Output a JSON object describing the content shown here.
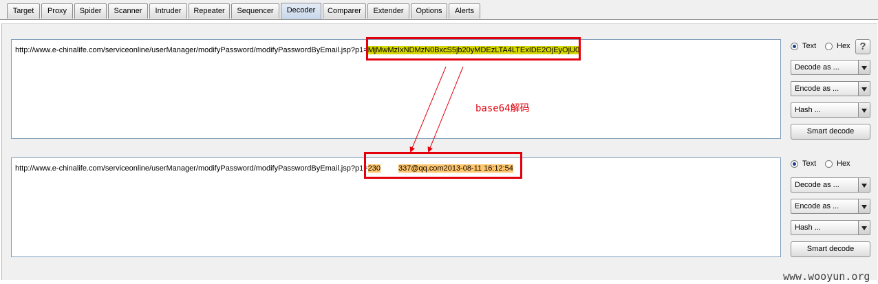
{
  "tabs": [
    "Target",
    "Proxy",
    "Spider",
    "Scanner",
    "Intruder",
    "Repeater",
    "Sequencer",
    "Decoder",
    "Comparer",
    "Extender",
    "Options",
    "Alerts"
  ],
  "active_tab": "Decoder",
  "top": {
    "url_prefix": "http://www.e-chinalife.com/serviceonline/userManager/modifyPassword/modifyPasswordByEmail.jsp?p1=",
    "encoded": "MjMwMzIxNDMzN0BxcS5jb20yMDEzLTA4LTExIDE2OjEyOjU0",
    "radio_text": "Text",
    "radio_hex": "Hex",
    "decode_as": "Decode as ...",
    "encode_as": "Encode as ...",
    "hash": "Hash ...",
    "smart": "Smart decode",
    "help": "?"
  },
  "bottom": {
    "url_prefix": "http://www.e-chinalife.com/serviceonline/userManager/modifyPassword/modifyPasswordByEmail.jsp?p1=",
    "decoded_a": "230",
    "decoded_b": "337@qq.com2013-08-11 16:12:54",
    "radio_text": "Text",
    "radio_hex": "Hex",
    "decode_as": "Decode as ...",
    "encode_as": "Encode as ...",
    "hash": "Hash ...",
    "smart": "Smart decode"
  },
  "annotation": "base64解码",
  "watermark": "www.wooyun.org",
  "colors": {
    "highlight_encoded": "#d6d600",
    "highlight_decoded": "#ffc66d",
    "annotation_red": "#e3000b"
  }
}
